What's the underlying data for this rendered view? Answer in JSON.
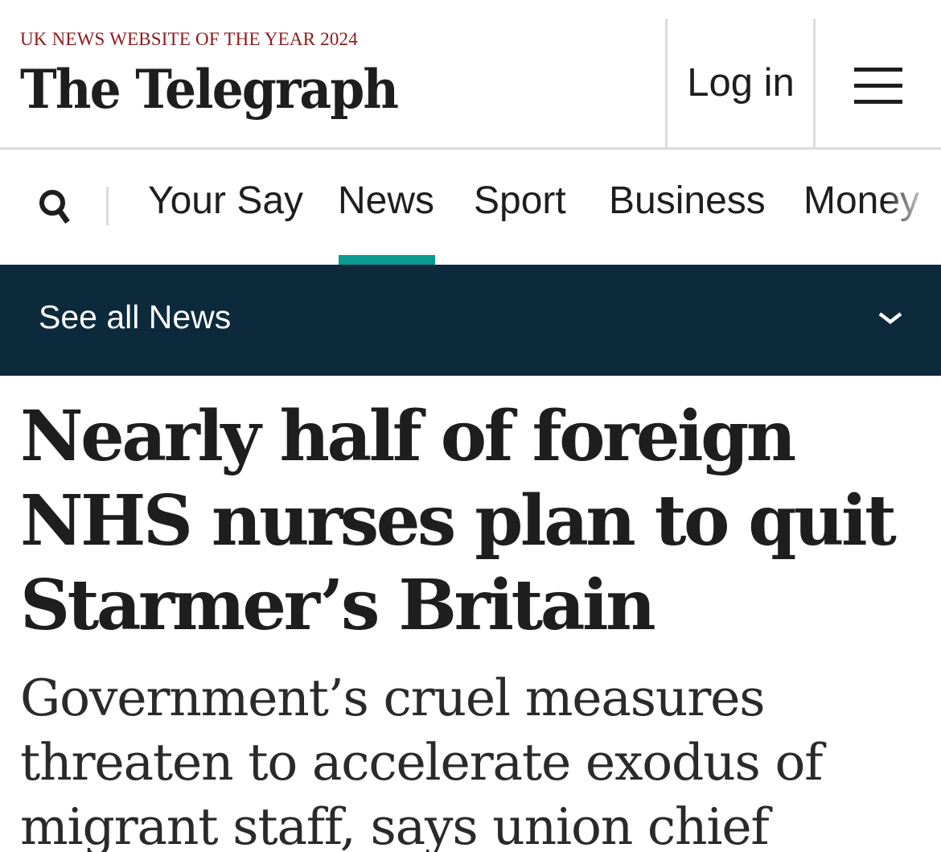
{
  "header": {
    "award": "UK NEWS WEBSITE OF THE YEAR 2024",
    "logo": "The Telegraph",
    "login_label": "Log in",
    "menu_icon": "hamburger-menu-icon"
  },
  "nav": {
    "search_icon": "search-icon",
    "items": [
      {
        "label": "Your Say",
        "active": false
      },
      {
        "label": "News",
        "active": true
      },
      {
        "label": "Sport",
        "active": false
      },
      {
        "label": "Business",
        "active": false
      },
      {
        "label": "Money",
        "active": false
      }
    ],
    "active_color": "#0a9a92"
  },
  "section_bar": {
    "label": "See all News",
    "icon": "chevron-down-icon",
    "background": "#0c2a3c"
  },
  "article": {
    "headline": "Nearly half of foreign NHS nurses plan to quit Starmer’s Britain",
    "standfirst": "Government’s cruel measures threaten to accelerate exodus of migrant staff, says union chief"
  },
  "colors": {
    "award_red": "#8b1a1a",
    "text": "#1e1e1e"
  }
}
